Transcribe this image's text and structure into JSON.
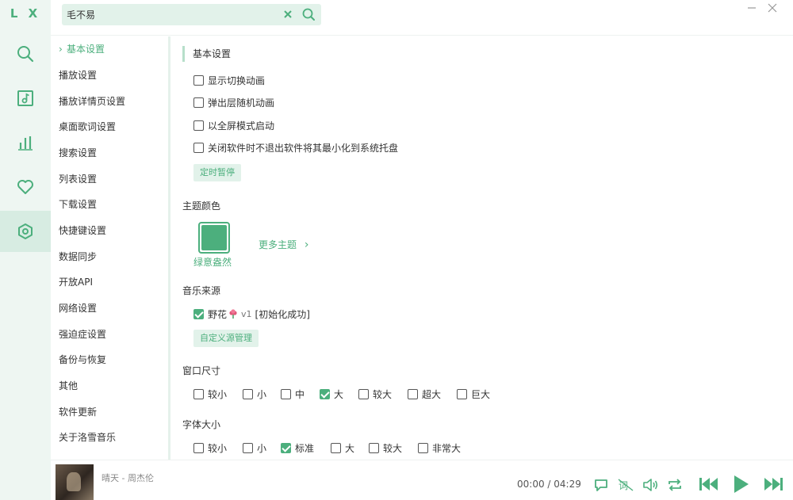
{
  "app": {
    "logo": "L X"
  },
  "search": {
    "value": "毛不易",
    "placeholder": ""
  },
  "rail": [
    {
      "icon": "search-icon"
    },
    {
      "icon": "music-list-icon"
    },
    {
      "icon": "leaderboard-icon"
    },
    {
      "icon": "heart-icon"
    },
    {
      "icon": "settings-icon",
      "active": true
    }
  ],
  "nav": {
    "items": [
      {
        "label": "基本设置",
        "active": true
      },
      {
        "label": "播放设置"
      },
      {
        "label": "播放详情页设置"
      },
      {
        "label": "桌面歌词设置"
      },
      {
        "label": "搜索设置"
      },
      {
        "label": "列表设置"
      },
      {
        "label": "下载设置"
      },
      {
        "label": "快捷键设置"
      },
      {
        "label": "数据同步"
      },
      {
        "label": "开放API"
      },
      {
        "label": "网络设置"
      },
      {
        "label": "强迫症设置"
      },
      {
        "label": "备份与恢复"
      },
      {
        "label": "其他"
      },
      {
        "label": "软件更新"
      },
      {
        "label": "关于洛雪音乐"
      }
    ]
  },
  "basic": {
    "title": "基本设置",
    "options": [
      {
        "label": "显示切换动画",
        "checked": false
      },
      {
        "label": "弹出层随机动画",
        "checked": false
      },
      {
        "label": "以全屏模式启动",
        "checked": false
      },
      {
        "label": "关闭软件时不退出软件将其最小化到系统托盘",
        "checked": false
      }
    ],
    "timer_button": "定时暂停"
  },
  "theme": {
    "title": "主题颜色",
    "current_name": "绿意盎然",
    "current_color": "#4caf7d",
    "more": "更多主题"
  },
  "source": {
    "title": "音乐来源",
    "name": "野花",
    "icon": "flower-icon",
    "version": "v1",
    "status": "[初始化成功]",
    "checked": true,
    "manage_button": "自定义源管理"
  },
  "window_size": {
    "title": "窗口尺寸",
    "options": [
      {
        "label": "较小",
        "checked": false
      },
      {
        "label": "小",
        "checked": false
      },
      {
        "label": "中",
        "checked": false
      },
      {
        "label": "大",
        "checked": true
      },
      {
        "label": "较大",
        "checked": false
      },
      {
        "label": "超大",
        "checked": false
      },
      {
        "label": "巨大",
        "checked": false
      }
    ]
  },
  "font_size": {
    "title": "字体大小",
    "options": [
      {
        "label": "较小",
        "checked": false
      },
      {
        "label": "小",
        "checked": false
      },
      {
        "label": "标准",
        "checked": true
      },
      {
        "label": "大",
        "checked": false
      },
      {
        "label": "较大",
        "checked": false
      },
      {
        "label": "非常大",
        "checked": false
      }
    ]
  },
  "player": {
    "track": "晴天 - 周杰伦",
    "time": "00:00 / 04:29",
    "controls": [
      "comment-icon",
      "lyric-icon",
      "volume-icon",
      "repeat-icon",
      "previous-icon",
      "play-icon",
      "next-icon"
    ]
  },
  "colors": {
    "accent": "#4caf7d",
    "accent_light": "#e2f2ea",
    "rail_bg": "#eef6f2"
  }
}
